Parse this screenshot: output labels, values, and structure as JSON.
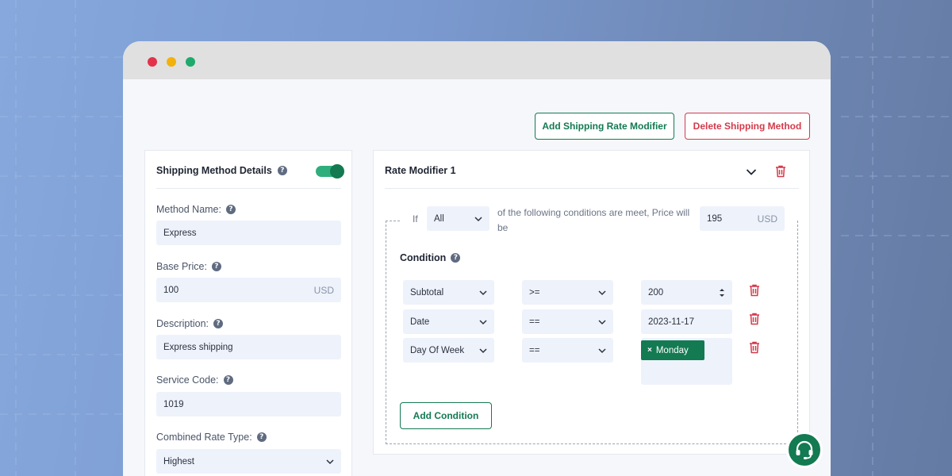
{
  "toolbar": {
    "add_modifier_label": "Add Shipping Rate Modifier",
    "delete_method_label": "Delete Shipping Method"
  },
  "left_panel": {
    "title": "Shipping Method Details",
    "enabled": true,
    "fields": {
      "method_name": {
        "label": "Method Name:",
        "value": "Express"
      },
      "base_price": {
        "label": "Base Price:",
        "value": "100",
        "unit": "USD"
      },
      "description": {
        "label": "Description:",
        "value": "Express shipping"
      },
      "service_code": {
        "label": "Service Code:",
        "value": "1019"
      },
      "combined_rate_type": {
        "label": "Combined Rate Type:",
        "value": "Highest"
      }
    }
  },
  "rate_modifier": {
    "title": "Rate Modifier 1",
    "if_label": "If",
    "match_mode": "All",
    "conditions_text": "of the following conditions are meet, Price will be",
    "price": "195",
    "price_unit": "USD",
    "condition_title": "Condition",
    "conditions": [
      {
        "field": "Subtotal",
        "operator": ">=",
        "value": "200"
      },
      {
        "field": "Date",
        "operator": "==",
        "value": "2023-11-17"
      },
      {
        "field": "Day Of Week",
        "operator": "==",
        "tags": [
          "Monday"
        ]
      }
    ],
    "add_condition_label": "Add Condition"
  },
  "colors": {
    "brand_green": "#137a52",
    "danger_red": "#d33a4b",
    "toggle_green": "#2fae7d"
  },
  "icons": {
    "help": "question-circle-icon",
    "chevron": "chevron-down-icon",
    "trash": "trash-icon",
    "support": "headset-icon",
    "tag_remove": "x-icon"
  }
}
